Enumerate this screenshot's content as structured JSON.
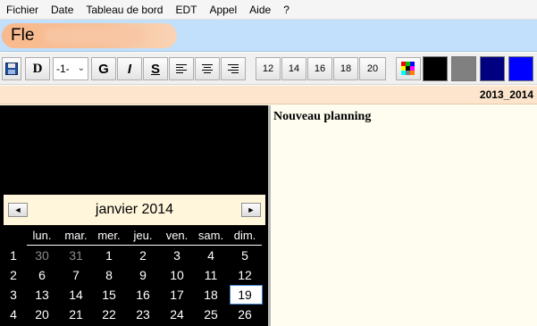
{
  "menu": [
    "Fichier",
    "Date",
    "Tableau de bord",
    "EDT",
    "Appel",
    "Aide",
    "?"
  ],
  "name_bar": {
    "text": "Fle"
  },
  "toolbar": {
    "bold_d": "D",
    "font_size_combo": "-1-",
    "g_label": "G",
    "i_label": "I",
    "s_label": "S",
    "sizes": [
      "12",
      "14",
      "16",
      "18",
      "20"
    ],
    "swatch_colors": [
      "#000000",
      "#808080",
      "#000080",
      "#0000ff"
    ]
  },
  "year_label": "2013_2014",
  "planning_title": "Nouveau planning",
  "calendar": {
    "month": "janvier 2014",
    "prev": "◄",
    "next": "►",
    "weekdays": [
      "lun.",
      "mar.",
      "mer.",
      "jeu.",
      "ven.",
      "sam.",
      "dim."
    ],
    "weeks": [
      {
        "num": "1",
        "days": [
          "30",
          "31",
          "1",
          "2",
          "3",
          "4",
          "5"
        ]
      },
      {
        "num": "2",
        "days": [
          "6",
          "7",
          "8",
          "9",
          "10",
          "11",
          "12"
        ]
      },
      {
        "num": "3",
        "days": [
          "13",
          "14",
          "15",
          "16",
          "17",
          "18",
          "19"
        ]
      },
      {
        "num": "4",
        "days": [
          "20",
          "21",
          "22",
          "23",
          "24",
          "25",
          "26"
        ]
      }
    ],
    "selected_day": "19"
  }
}
